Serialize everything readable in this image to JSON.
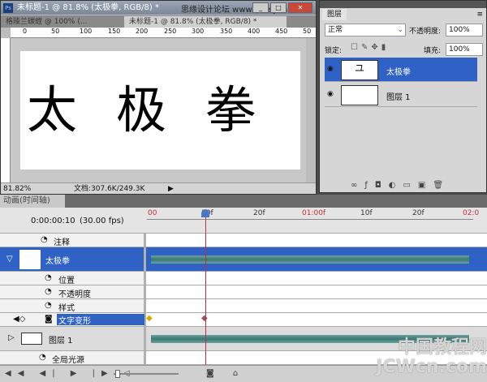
{
  "document_window": {
    "title": "未标题-1 @ 81.8% (太极拳, RGB/8) *",
    "overlay_text": "思缘设计论坛 www.missyuan.com",
    "tabs": [
      {
        "label": "格陵兰碳蛭 @ 100% (..."
      },
      {
        "label": "未标题-1 @ 81.8% (太极拳, RGB/8) *",
        "active": true
      }
    ],
    "ruler_ticks": [
      "0",
      "50",
      "100",
      "150",
      "200",
      "250",
      "300",
      "350",
      "400",
      "450",
      "50"
    ],
    "canvas_text": "太极拳",
    "zoom": "81.82%",
    "doc_info": "文档:307.6K/249.3K"
  },
  "layers_panel": {
    "tab": "图层",
    "blend_mode": "正常",
    "opacity_label": "不透明度:",
    "opacity": "100%",
    "lock_label": "锁定:",
    "fill_label": "填充:",
    "fill": "100%",
    "layers": [
      {
        "name": "太极拳",
        "selected": true
      },
      {
        "name": "图层 1",
        "selected": false
      }
    ],
    "accent": "#2f62c4"
  },
  "timeline": {
    "tab": "动画(时间轴)",
    "current_time": "0:00:00:10",
    "fps": "(30.00 fps)",
    "ruler": [
      "00",
      "10f",
      "20f",
      "01:00f",
      "10f",
      "20f",
      "02:0"
    ],
    "rows": {
      "comments": "注释",
      "layer1": "太极拳",
      "position": "位置",
      "opacity": "不透明度",
      "style": "样式",
      "warp": "文字变形",
      "layer2": "图层 1",
      "global_light": "全局光源"
    }
  },
  "watermark": "中国教程网 JCWcn.com"
}
